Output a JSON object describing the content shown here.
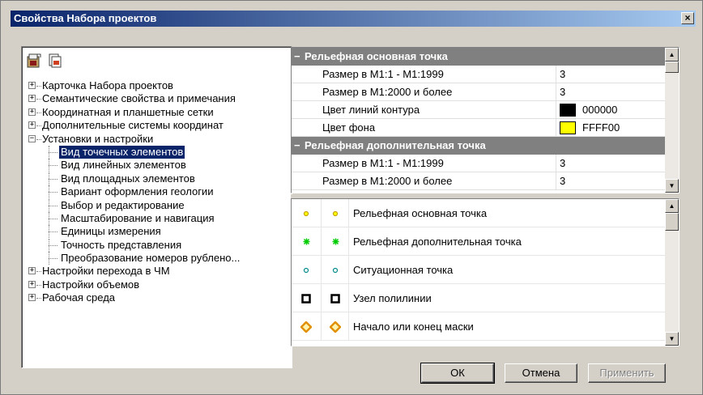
{
  "window": {
    "title": "Свойства Набора проектов",
    "close_glyph": "×"
  },
  "toolbar": {
    "icons": [
      "project-save-icon",
      "project-copy-icon"
    ]
  },
  "tree": {
    "items": [
      {
        "label": "Карточка Набора проектов",
        "expander": "+",
        "level": 0
      },
      {
        "label": "Семантические свойства и примечания",
        "expander": "+",
        "level": 0
      },
      {
        "label": "Координатная и планшетные сетки",
        "expander": "+",
        "level": 0
      },
      {
        "label": "Дополнительные системы координат",
        "expander": "+",
        "level": 0
      },
      {
        "label": "Установки и настройки",
        "expander": "−",
        "level": 0
      },
      {
        "label": "Вид точечных элементов",
        "level": 1,
        "selected": true
      },
      {
        "label": "Вид линейных элементов",
        "level": 1
      },
      {
        "label": "Вид площадных элементов",
        "level": 1
      },
      {
        "label": "Вариант оформления геологии",
        "level": 1
      },
      {
        "label": "Выбор и редактирование",
        "level": 1
      },
      {
        "label": "Масштабирование и навигация",
        "level": 1
      },
      {
        "label": "Единицы измерения",
        "level": 1
      },
      {
        "label": "Точность представления",
        "level": 1
      },
      {
        "label": "Преобразование номеров рублено...",
        "level": 1
      },
      {
        "label": "Настройки перехода в ЧМ",
        "expander": "+",
        "level": 0
      },
      {
        "label": "Настройки объемов",
        "expander": "+",
        "level": 0
      },
      {
        "label": "Рабочая среда",
        "expander": "+",
        "level": 0
      }
    ]
  },
  "properties": {
    "groups": [
      {
        "title": "Рельефная основная точка",
        "toggle": "−",
        "rows": [
          {
            "name": "Размер в М1:1 - М1:1999",
            "value": "3"
          },
          {
            "name": "Размер в М1:2000 и более",
            "value": "3"
          },
          {
            "name": "Цвет линий контура",
            "value": "000000",
            "swatch": "#000000"
          },
          {
            "name": "Цвет фона",
            "value": "FFFF00",
            "swatch": "#ffff00"
          }
        ]
      },
      {
        "title": "Рельефная дополнительная точка",
        "toggle": "−",
        "rows": [
          {
            "name": "Размер в М1:1 - М1:1999",
            "value": "3"
          },
          {
            "name": "Размер в М1:2000 и более",
            "value": "3"
          }
        ]
      }
    ]
  },
  "legend": {
    "items": [
      {
        "label": "Рельефная основная точка",
        "symbol": "dot-yellow-icon",
        "color": "#c8a000"
      },
      {
        "label": "Рельефная дополнительная точка",
        "symbol": "asterisk-green-icon",
        "color": "#00cc00"
      },
      {
        "label": "Ситуационная точка",
        "symbol": "dot-teal-icon",
        "color": "#008b8b"
      },
      {
        "label": "Узел полилинии",
        "symbol": "square-node-icon",
        "color": "#000000"
      },
      {
        "label": "Начало или конец маски",
        "symbol": "diamond-orange-icon",
        "color": "#e09000"
      }
    ]
  },
  "buttons": {
    "ok": "ОК",
    "cancel": "Отмена",
    "apply": "Применить"
  },
  "scrollbar": {
    "up_glyph": "▲",
    "down_glyph": "▼"
  }
}
